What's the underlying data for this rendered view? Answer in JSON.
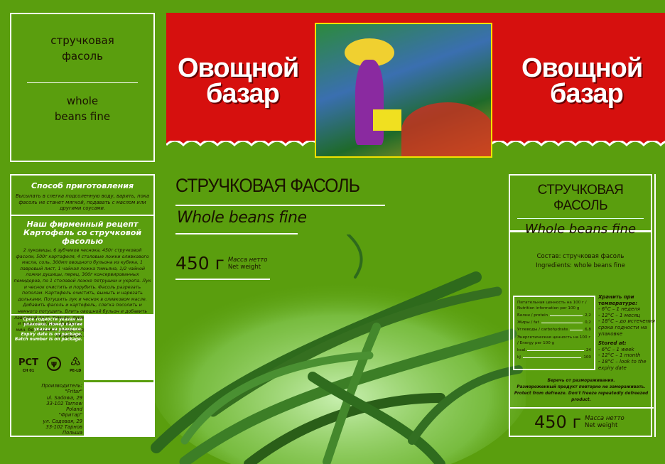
{
  "top_left_panel": {
    "name_ru": "стручковая фасоль",
    "name_en": "whole beans fine"
  },
  "brand": {
    "logo_line1": "Овощной",
    "logo_line2": "базар"
  },
  "main": {
    "title_ru": "СТРУЧКОВАЯ ФАСОЛЬ",
    "title_en": "Whole beans fine",
    "weight": "450 г",
    "weight_label_ru": "Масса нетто",
    "weight_label_en": "Net weight"
  },
  "preparation": {
    "heading": "Способ приготовления",
    "text": "Высыпать в слегка подсоленную воду, варить, пока фасоль не станет мягкой, подавать с маслом или другими соусами."
  },
  "recipe": {
    "heading1": "Наш фирменный рецепт",
    "heading2": "Картофель со стручковой фасолью",
    "text": "2 луковицы, 6 зубчиков чеснока, 450г стручковой фасоли, 500г картофеля, 4 столовые ложки оливкового масла, соль, 300мл овощного бульона из кубика, 1 лавровый лист, 1 чайная ложка тимьяна, 1/2 чайной ложки душицы, перец, 300г консервированных помидоров, по 1 столовой ложке петрушки и укропа. Лук и чеснок очистить и порубить. Фасоль разрезать пополам. Картофель очистить, вымыть и нарезать дольками. Потушить лук и чеснок в оливковом масле. Добавить фасоль и картофель, слегка посолить и немного потушить. Влить овощной бульон и добавить лавровый лист, тимьян, душицу и перец. Накрыть овощи и тушить 15 мин. Добавить помидоры и тушить еще 8 мин. без крышки. Перед подачей на стол перемешать с петрушкой и укропом."
  },
  "expiry": {
    "text_ru": "Срок годности указан на упаковке. Номер партии указан на упаковке.",
    "text_en": "Expiry date is on package. Batch number is on package."
  },
  "certifications": [
    {
      "icon": "rst-mark-icon",
      "label": "CH 01"
    },
    {
      "icon": "ukraine-quality-mark-icon",
      "label": ""
    },
    {
      "icon": "recycle-icon",
      "label": "PE-LD"
    }
  ],
  "producer": {
    "lines": [
      "Производитель:",
      "\"Fritar\"",
      "ul. Sadowa, 29",
      "33-102 Tarnow",
      "Poland",
      "\"Фритар\"",
      "ул. Садовая, 29",
      "33-102 Тарнов",
      "Польша"
    ]
  },
  "ingredients": {
    "ru": "Состав: стручковая фасоль",
    "en": "Ingredients: whole beans fine"
  },
  "nutrition": {
    "heading": "Питательная ценность на 100 г / Nutrition information per 100 g",
    "rows": [
      {
        "label": "Белки / protein",
        "value": "2,2"
      },
      {
        "label": "Жиры / fat",
        "value": "0,2"
      },
      {
        "label": "Углеводы / carbohydrate",
        "value": "6,8"
      }
    ],
    "energy_heading": "Энергетическая ценность на 100 г / Energy per 100 g",
    "energy": [
      {
        "label": "kcal",
        "value": "24"
      },
      {
        "label": "kJ",
        "value": "100"
      }
    ]
  },
  "storage": {
    "heading_ru": "Хранить при температуре:",
    "lines_ru": [
      "- 6°C – 1 неделя",
      "- 12°C – 1 месяц",
      "- 18°C – до истечения срока годности на упаковке"
    ],
    "heading_en": "Stored at:",
    "lines_en": [
      "- 6°C – 1 week",
      "- 12°C – 1 month",
      "- 18°C – look to the expiry date"
    ]
  },
  "warning": {
    "line1": "Беречь от размораживания.",
    "line2": "Размороженный продукт повторно не замораживать.",
    "line3": "Protect from defreeze. Don't freeze repeatedly defreezed product."
  },
  "colors": {
    "background": "#5a9e0e",
    "banner": "#d6100e",
    "frame": "#f2e200"
  }
}
